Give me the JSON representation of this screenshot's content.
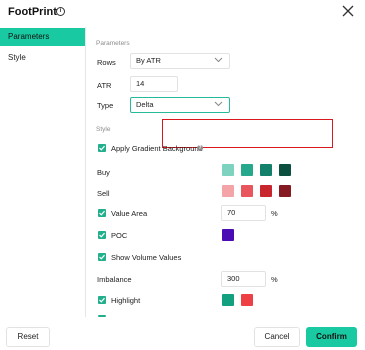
{
  "dialog": {
    "title": "FootPrint"
  },
  "sidebar": {
    "items": [
      {
        "label": "Parameters",
        "active": true
      },
      {
        "label": "Style",
        "active": false
      }
    ]
  },
  "parameters": {
    "section_label": "Parameters",
    "rows": {
      "label": "Rows",
      "value": "By ATR"
    },
    "atr": {
      "label": "ATR",
      "value": "14"
    },
    "type": {
      "label": "Type",
      "value": "Delta"
    }
  },
  "style": {
    "section_label": "Style",
    "apply_gradient": {
      "label": "Apply Gradient Background",
      "checked": true
    },
    "buy": {
      "label": "Buy",
      "colors": [
        "#7dd3c0",
        "#26a88c",
        "#12806a",
        "#0c4f3f"
      ]
    },
    "sell": {
      "label": "Sell",
      "colors": [
        "#f4a3a6",
        "#e8555c",
        "#c9252f",
        "#861a22"
      ]
    },
    "value_area": {
      "label": "Value Area",
      "checked": true,
      "value": "70",
      "unit": "%"
    },
    "poc": {
      "label": "POC",
      "checked": true,
      "color": "#4a0ab4"
    },
    "show_volume": {
      "label": "Show Volume Values",
      "checked": true
    },
    "imbalance": {
      "label": "Imbalance",
      "value": "300",
      "unit": "%"
    },
    "highlight": {
      "label": "Highlight",
      "checked": true,
      "colors": [
        "#13a081",
        "#ee3f45"
      ]
    }
  },
  "footer": {
    "reset_label": "Reset",
    "cancel_label": "Cancel",
    "confirm_label": "Confirm"
  },
  "colors": {
    "accent": "#19c9a1",
    "annotation": "#d8181c"
  }
}
